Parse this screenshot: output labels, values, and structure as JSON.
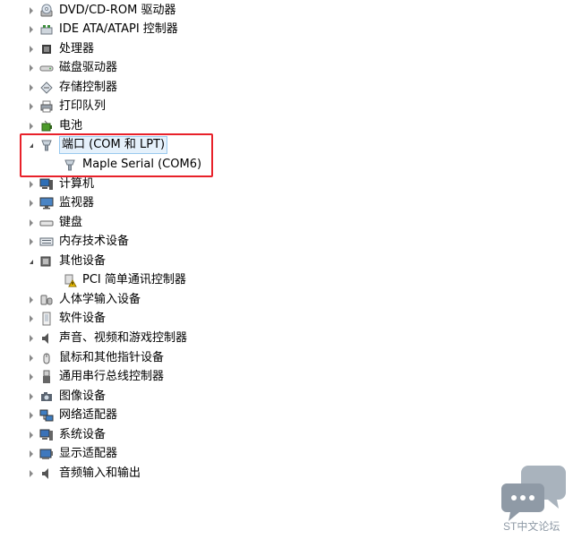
{
  "device_tree": {
    "items": [
      {
        "label": "DVD/CD-ROM 驱动器",
        "icon": "dvd-drive-icon",
        "state": "collapsed",
        "level": 0
      },
      {
        "label": "IDE ATA/ATAPI 控制器",
        "icon": "ide-controller-icon",
        "state": "collapsed",
        "level": 0
      },
      {
        "label": "处理器",
        "icon": "processor-icon",
        "state": "collapsed",
        "level": 0
      },
      {
        "label": "磁盘驱动器",
        "icon": "disk-drive-icon",
        "state": "collapsed",
        "level": 0
      },
      {
        "label": "存储控制器",
        "icon": "storage-controller-icon",
        "state": "collapsed",
        "level": 0
      },
      {
        "label": "打印队列",
        "icon": "printer-icon",
        "state": "collapsed",
        "level": 0
      },
      {
        "label": "电池",
        "icon": "battery-icon",
        "state": "collapsed",
        "level": 0
      },
      {
        "label": "端口 (COM 和 LPT)",
        "icon": "port-icon",
        "state": "expanded",
        "level": 0
      },
      {
        "label": "Maple Serial (COM6)",
        "icon": "serial-port-icon",
        "state": "leaf",
        "level": 1
      },
      {
        "label": "计算机",
        "icon": "computer-icon",
        "state": "collapsed",
        "level": 0
      },
      {
        "label": "监视器",
        "icon": "monitor-icon",
        "state": "collapsed",
        "level": 0
      },
      {
        "label": "键盘",
        "icon": "keyboard-icon",
        "state": "collapsed",
        "level": 0
      },
      {
        "label": "内存技术设备",
        "icon": "memory-device-icon",
        "state": "collapsed",
        "level": 0
      },
      {
        "label": "其他设备",
        "icon": "other-devices-icon",
        "state": "expanded",
        "level": 0
      },
      {
        "label": "PCI 简单通讯控制器",
        "icon": "warning-device-icon",
        "state": "leaf",
        "level": 1
      },
      {
        "label": "人体学输入设备",
        "icon": "hid-icon",
        "state": "collapsed",
        "level": 0
      },
      {
        "label": "软件设备",
        "icon": "software-device-icon",
        "state": "collapsed",
        "level": 0
      },
      {
        "label": "声音、视频和游戏控制器",
        "icon": "audio-icon",
        "state": "collapsed",
        "level": 0
      },
      {
        "label": "鼠标和其他指针设备",
        "icon": "mouse-icon",
        "state": "collapsed",
        "level": 0
      },
      {
        "label": "通用串行总线控制器",
        "icon": "usb-icon",
        "state": "collapsed",
        "level": 0
      },
      {
        "label": "图像设备",
        "icon": "camera-icon",
        "state": "collapsed",
        "level": 0
      },
      {
        "label": "网络适配器",
        "icon": "network-adapter-icon",
        "state": "collapsed",
        "level": 0
      },
      {
        "label": "系统设备",
        "icon": "system-device-icon",
        "state": "collapsed",
        "level": 0
      },
      {
        "label": "显示适配器",
        "icon": "display-adapter-icon",
        "state": "collapsed",
        "level": 0
      },
      {
        "label": "音频输入和输出",
        "icon": "audio-io-icon",
        "state": "collapsed",
        "level": 0
      }
    ]
  },
  "highlight": {
    "color": "#e8212a"
  },
  "watermark": {
    "text": "ST中文论坛",
    "icon": "chat-bubbles-icon",
    "color": "#8f9aa6"
  }
}
